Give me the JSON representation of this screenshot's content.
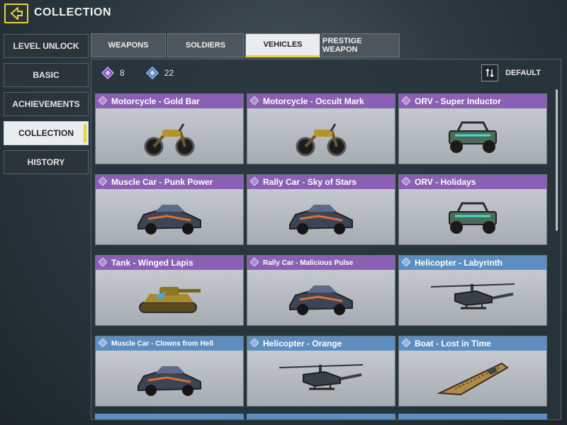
{
  "header": {
    "title": "COLLECTION"
  },
  "sidebar": {
    "items": [
      {
        "label": "LEVEL UNLOCK"
      },
      {
        "label": "BASIC"
      },
      {
        "label": "ACHIEVEMENTS"
      },
      {
        "label": "COLLECTION",
        "active": true
      },
      {
        "label": "HISTORY"
      }
    ]
  },
  "tabs": [
    {
      "label": "WEAPONS"
    },
    {
      "label": "SOLDIERS"
    },
    {
      "label": "VEHICLES",
      "active": true
    },
    {
      "label": "PRESTIGE WEAPON"
    }
  ],
  "stats": {
    "purple_count": "8",
    "blue_count": "22"
  },
  "sort": {
    "label": "DEFAULT"
  },
  "colors": {
    "accent": "#e8d23a",
    "epic": "#8a5fb4",
    "rare": "#5c8ec0"
  },
  "cards": [
    {
      "title": "Motorcycle - Gold Bar",
      "rarity": "purple",
      "icon": "motorcycle"
    },
    {
      "title": "Motorcycle - Occult Mark",
      "rarity": "purple",
      "icon": "motorcycle"
    },
    {
      "title": "ORV - Super Inductor",
      "rarity": "purple",
      "icon": "orv"
    },
    {
      "title": "Muscle Car - Punk Power",
      "rarity": "purple",
      "icon": "car"
    },
    {
      "title": "Rally Car - Sky of Stars",
      "rarity": "purple",
      "icon": "car"
    },
    {
      "title": "ORV - Holidays",
      "rarity": "purple",
      "icon": "orv"
    },
    {
      "title": "Tank - Winged Lapis",
      "rarity": "purple",
      "icon": "tank"
    },
    {
      "title": "Rally Car - Malicious Pulse",
      "rarity": "purple",
      "icon": "car"
    },
    {
      "title": "Helicopter - Labyrinth",
      "rarity": "blue",
      "icon": "helicopter"
    },
    {
      "title": "Muscle Car - Clowns from Hell",
      "rarity": "blue",
      "icon": "car"
    },
    {
      "title": "Helicopter - Orange",
      "rarity": "blue",
      "icon": "helicopter"
    },
    {
      "title": "Boat - Lost in Time",
      "rarity": "blue",
      "icon": "boat"
    }
  ]
}
